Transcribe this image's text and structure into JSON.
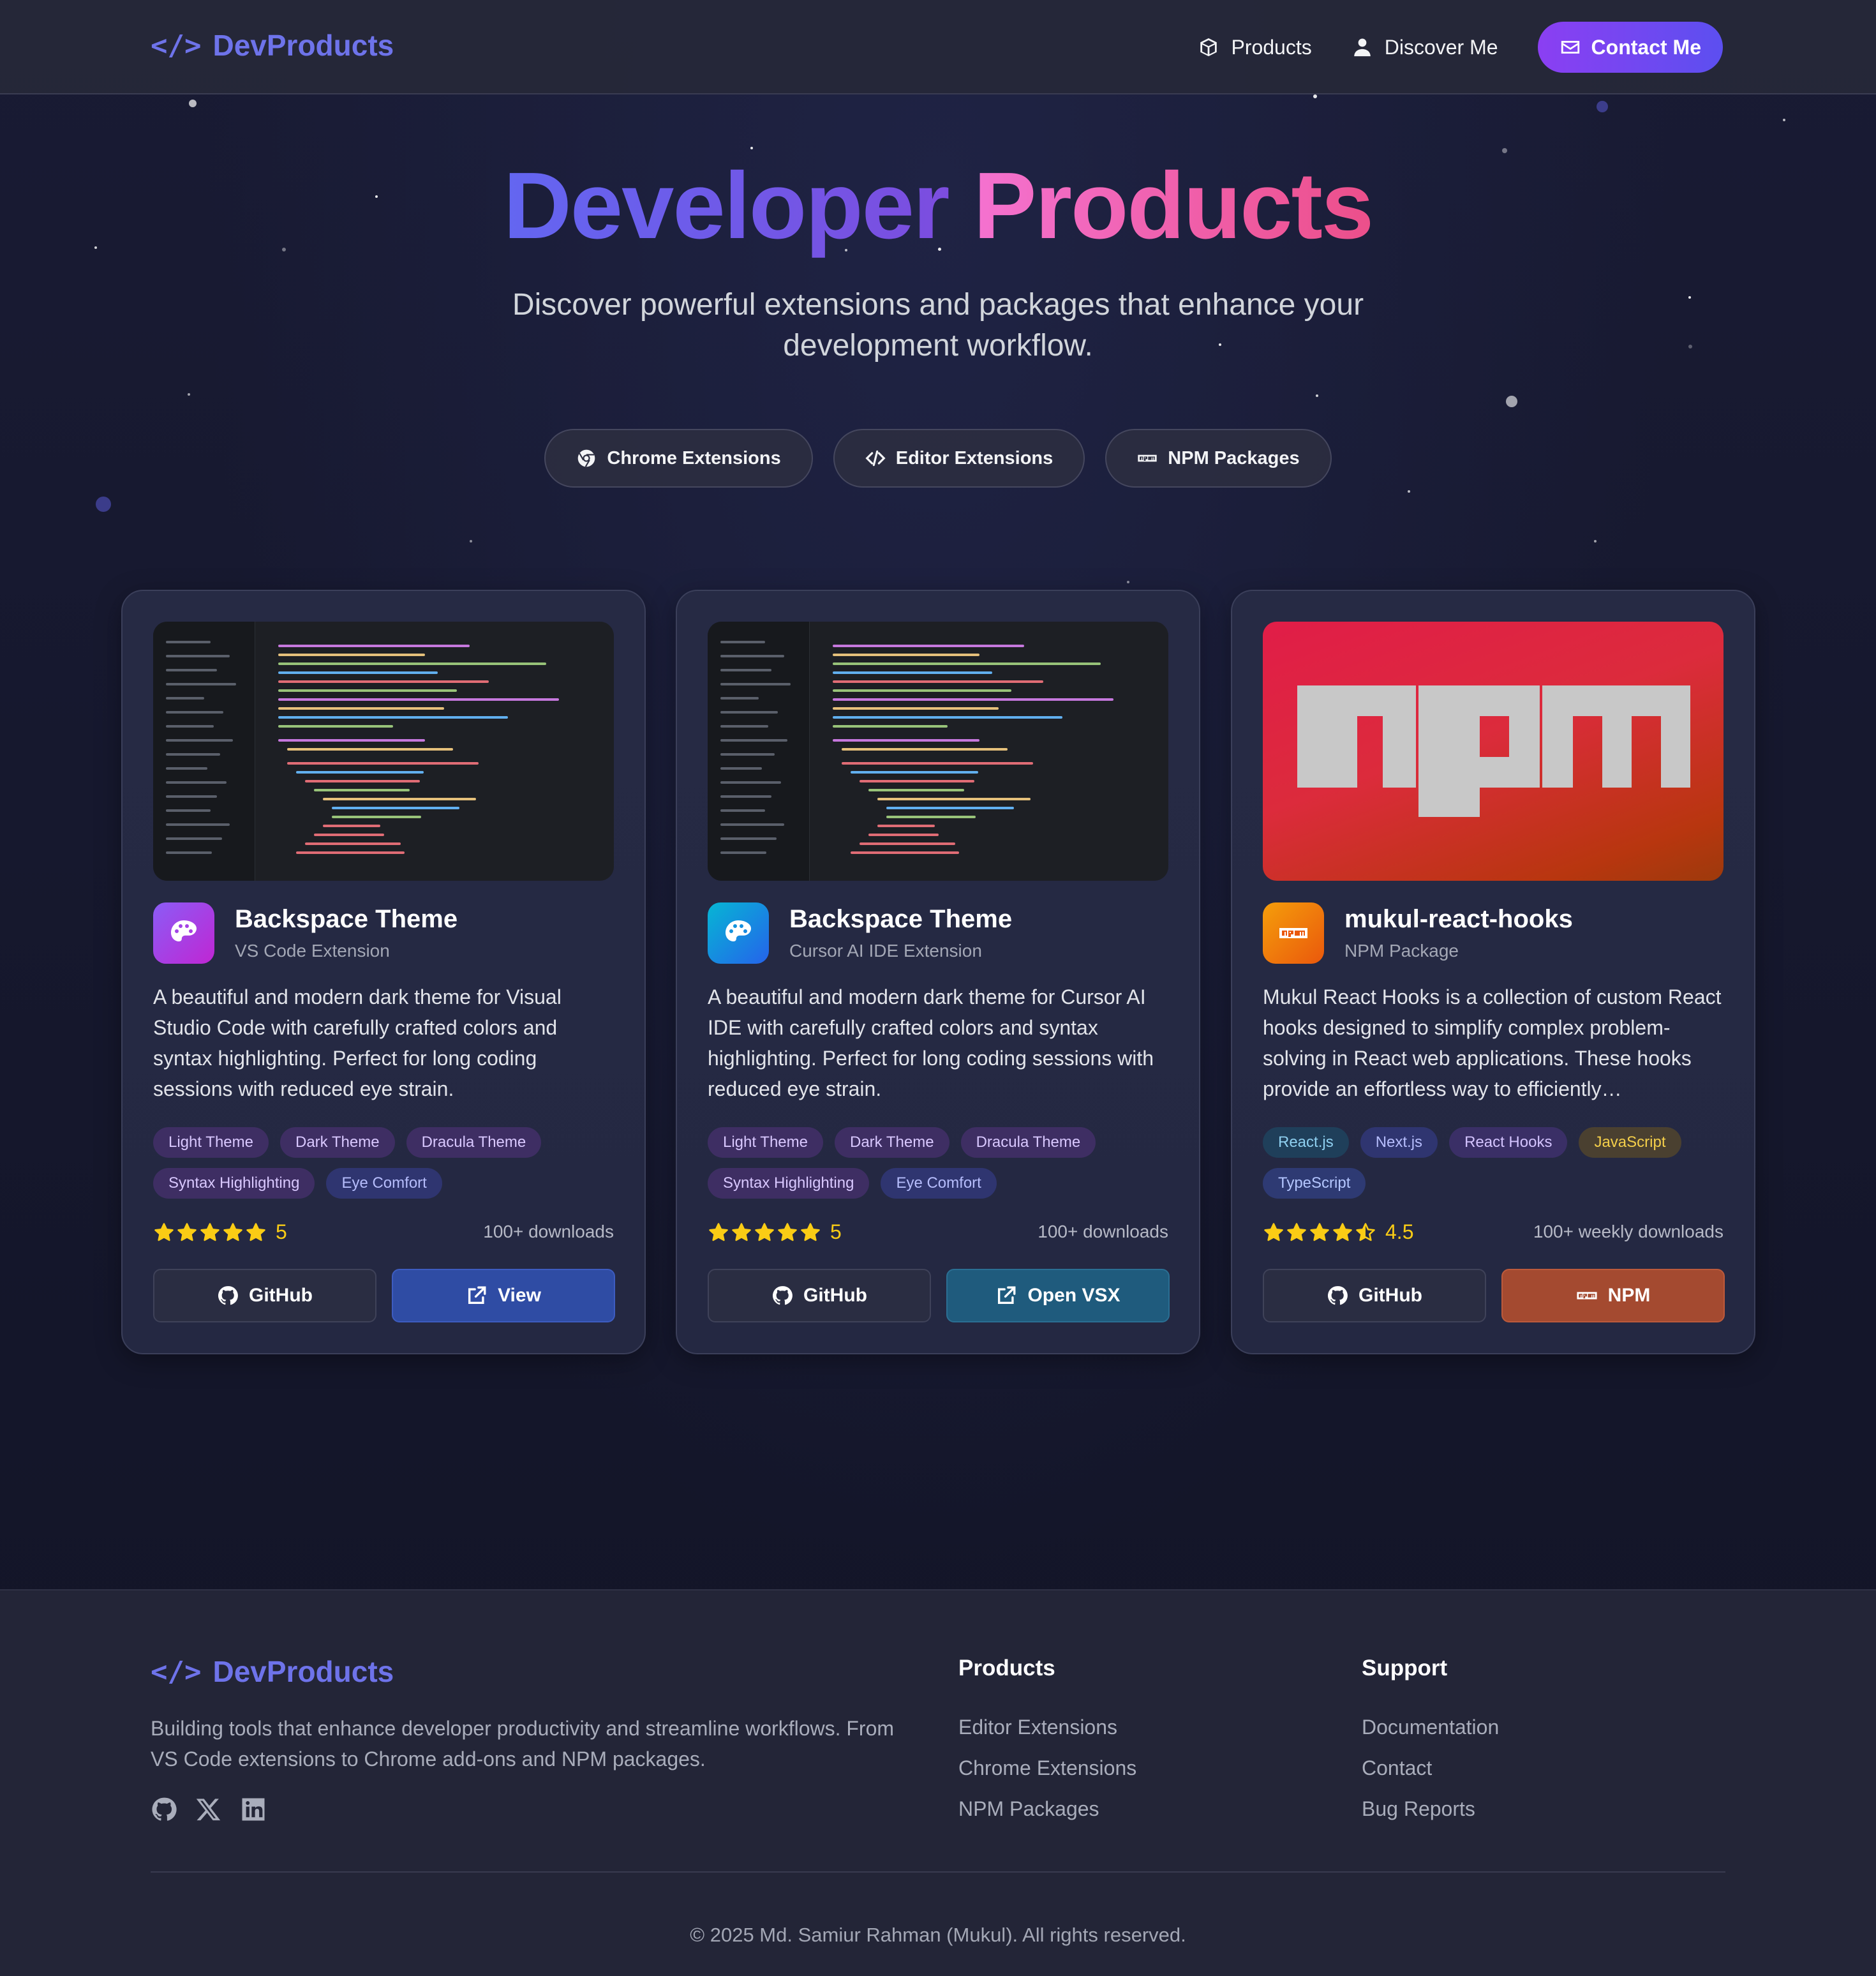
{
  "nav": {
    "brand": "DevProducts",
    "links": [
      {
        "label": "Products",
        "icon": "box-icon"
      },
      {
        "label": "Discover Me",
        "icon": "user-icon"
      }
    ],
    "contact_label": "Contact Me"
  },
  "hero": {
    "title_part1": "Developer",
    "title_part2": "Products",
    "subtitle": "Discover powerful extensions and packages that enhance your development workflow.",
    "filters": [
      {
        "label": "Chrome Extensions",
        "icon": "chrome-icon"
      },
      {
        "label": "Editor Extensions",
        "icon": "code-icon"
      },
      {
        "label": "NPM Packages",
        "icon": "npm-icon"
      }
    ]
  },
  "cards": [
    {
      "title": "Backspace Theme",
      "subtitle": "VS Code Extension",
      "description": "A beautiful and modern dark theme for Visual Studio Code with carefully crafted colors and syntax highlighting. Perfect for long coding sessions with reduced eye strain.",
      "tags": [
        "Light Theme",
        "Dark Theme",
        "Dracula Theme",
        "Syntax Highlighting",
        "Eye Comfort"
      ],
      "rating": "5",
      "rating_stars": 5,
      "downloads": "100+ downloads",
      "primary_button": "GitHub",
      "secondary_button": "View",
      "icon_color": "#8b5cf6"
    },
    {
      "title": "Backspace Theme",
      "subtitle": "Cursor AI IDE Extension",
      "description": "A beautiful and modern dark theme for Cursor AI IDE with carefully crafted colors and syntax highlighting. Perfect for long coding sessions with reduced eye strain.",
      "tags": [
        "Light Theme",
        "Dark Theme",
        "Dracula Theme",
        "Syntax Highlighting",
        "Eye Comfort"
      ],
      "rating": "5",
      "rating_stars": 5,
      "downloads": "100+ downloads",
      "primary_button": "GitHub",
      "secondary_button": "Open VSX",
      "icon_color": "#0ea5e9"
    },
    {
      "title": "mukul-react-hooks",
      "subtitle": "NPM Package",
      "description": "Mukul React Hooks is a collection of custom React hooks designed to simplify complex problem-solving in React web applications. These hooks provide an effortless way to efficiently…",
      "tags": [
        "React.js",
        "Next.js",
        "React Hooks",
        "JavaScript",
        "TypeScript"
      ],
      "rating": "4.5",
      "rating_stars": 4.5,
      "downloads": "100+ weekly downloads",
      "primary_button": "GitHub",
      "secondary_button": "NPM",
      "icon_color": "#f59e0b"
    }
  ],
  "footer": {
    "brand": "DevProducts",
    "description": "Building tools that enhance developer productivity and streamline workflows. From VS Code extensions to Chrome add-ons and NPM packages.",
    "socials": [
      "github-icon",
      "x-icon",
      "linkedin-icon"
    ],
    "products_heading": "Products",
    "products_links": [
      "Editor Extensions",
      "Chrome Extensions",
      "NPM Packages"
    ],
    "support_heading": "Support",
    "support_links": [
      "Documentation",
      "Contact",
      "Bug Reports"
    ],
    "copyright": "© 2025 Md. Samiur Rahman (Mukul). All rights reserved."
  },
  "colors": {
    "accent": "#6e73ea",
    "star": "#facc15"
  }
}
